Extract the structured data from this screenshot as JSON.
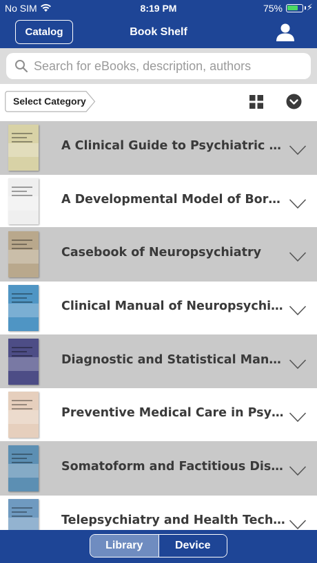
{
  "status_bar": {
    "carrier": "No SIM",
    "time": "8:19 PM",
    "battery": "75%",
    "battery_level": 0.75
  },
  "header": {
    "catalog_label": "Catalog",
    "title": "Book Shelf",
    "user_icon": "user-icon"
  },
  "search": {
    "placeholder": "Search for eBooks, description, authors",
    "value": ""
  },
  "toolbar": {
    "category_label": "Select Category",
    "grid_icon": "grid-icon",
    "sort_icon": "chevron-down-circle-icon"
  },
  "books": [
    {
      "title": "A Clinical Guide to Psychiatric Ethics",
      "cover_color": "#d8d2a6"
    },
    {
      "title": "A Developmental Model of Borderline Personality Disorder",
      "cover_color": "#efefef"
    },
    {
      "title": "Casebook of Neuropsychiatry",
      "cover_color": "#b9a88c"
    },
    {
      "title": "Clinical Manual of Neuropsychiatry",
      "cover_color": "#4f95c4"
    },
    {
      "title": "Diagnostic and Statistical Manual of Mental Disorders",
      "cover_color": "#4d4d86"
    },
    {
      "title": "Preventive Medical Care in Psychiatry",
      "cover_color": "#e6cfbd"
    },
    {
      "title": "Somatoform and Factitious Disorders",
      "cover_color": "#5c8fb3"
    },
    {
      "title": "Telepsychiatry and Health Technologies",
      "cover_color": "#6f9ac0"
    }
  ],
  "bottom_tabs": {
    "library": "Library",
    "device": "Device",
    "selected": "Library"
  },
  "colors": {
    "brand": "#1e4596",
    "row_shade": "#c9c9c9",
    "title_text": "#3a3a3a"
  }
}
